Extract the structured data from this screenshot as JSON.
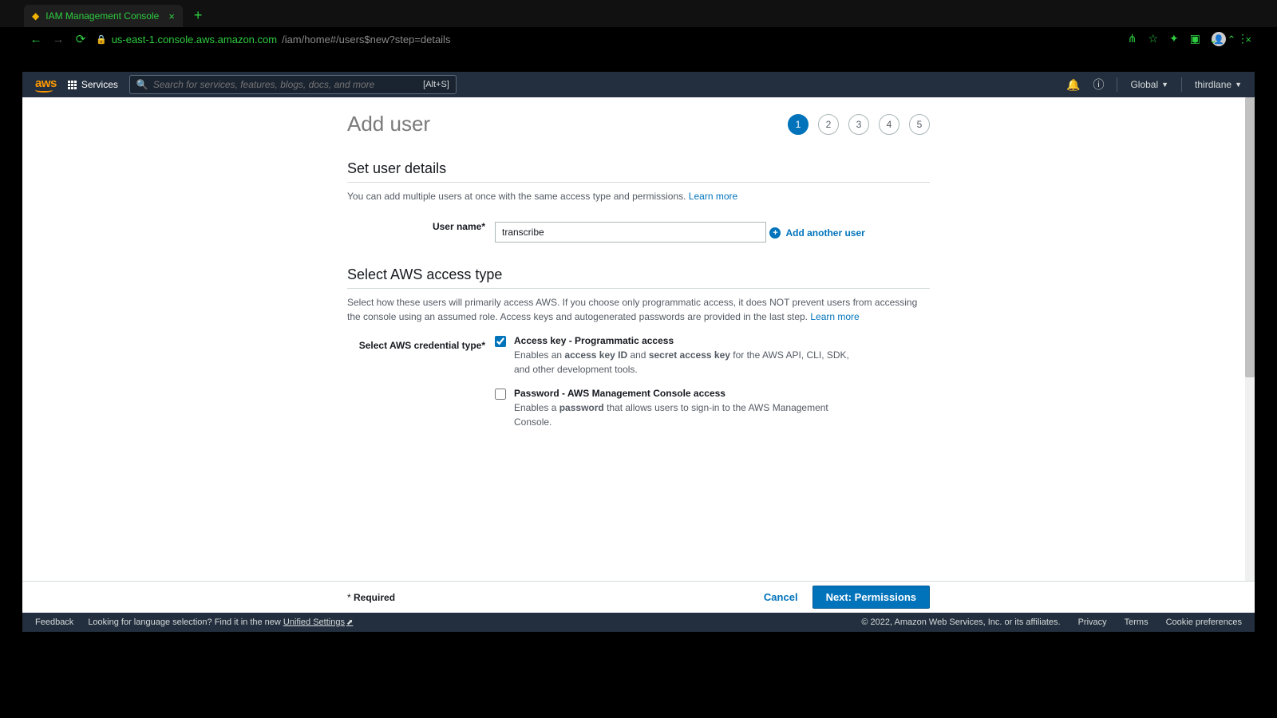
{
  "browser": {
    "tab_title": "IAM Management Console",
    "url_host": "us-east-1.console.aws.amazon.com",
    "url_path": "/iam/home#/users$new?step=details"
  },
  "aws_nav": {
    "services_label": "Services",
    "search_placeholder": "Search for services, features, blogs, docs, and more",
    "search_shortcut": "[Alt+S]",
    "region": "Global",
    "account": "thirdlane"
  },
  "page": {
    "title": "Add user",
    "steps": [
      "1",
      "2",
      "3",
      "4",
      "5"
    ],
    "active_step": 0
  },
  "user_details": {
    "title": "Set user details",
    "desc": "You can add multiple users at once with the same access type and permissions. ",
    "learn_more": "Learn more",
    "username_label": "User name*",
    "username_value": "transcribe",
    "add_another": "Add another user"
  },
  "access_type": {
    "title": "Select AWS access type",
    "desc": "Select how these users will primarily access AWS. If you choose only programmatic access, it does NOT prevent users from accessing the console using an assumed role. Access keys and autogenerated passwords are provided in the last step. ",
    "learn_more": "Learn more",
    "credential_label": "Select AWS credential type*",
    "option1": {
      "checked": true,
      "title": "Access key - Programmatic access",
      "desc_pre": "Enables an ",
      "desc_b1": "access key ID",
      "desc_mid": " and ",
      "desc_b2": "secret access key",
      "desc_post": " for the AWS API, CLI, SDK, and other development tools."
    },
    "option2": {
      "checked": false,
      "title": "Password - AWS Management Console access",
      "desc_pre": "Enables a ",
      "desc_b1": "password",
      "desc_post": " that allows users to sign-in to the AWS Management Console."
    }
  },
  "footer": {
    "required": "Required",
    "cancel": "Cancel",
    "next": "Next: Permissions"
  },
  "aws_footer": {
    "feedback": "Feedback",
    "lang_note": "Looking for language selection? Find it in the new ",
    "unified": "Unified Settings",
    "copyright": "© 2022, Amazon Web Services, Inc. or its affiliates.",
    "privacy": "Privacy",
    "terms": "Terms",
    "cookies": "Cookie preferences"
  }
}
